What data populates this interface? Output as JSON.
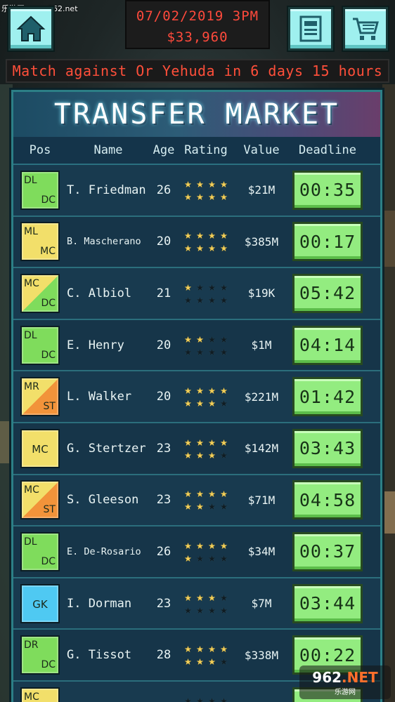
{
  "watermark_top": "乐游网 www.962.net",
  "header": {
    "date": "07/02/2019 3PM",
    "money": "$33,960",
    "home_icon": "home-icon",
    "news_icon": "newspaper-icon",
    "cart_icon": "cart-icon"
  },
  "ticker": "Match against Or Yehuda in 6 days 15 hours",
  "market": {
    "title": "TRANSFER MARKET",
    "columns": [
      "Pos",
      "Name",
      "Age",
      "Rating",
      "Value",
      "Deadline"
    ],
    "players": [
      {
        "pos1": "DL",
        "pos2": "DC",
        "name": "T. Friedman",
        "age": "26",
        "stars": 8,
        "value": "$21M",
        "deadline": "00:35",
        "colors": [
          "#7fdc5c",
          "#7fdc5c"
        ]
      },
      {
        "pos1": "ML",
        "pos2": "MC",
        "name": "B. Mascherano",
        "age": "20",
        "stars": 8,
        "value": "$385M",
        "deadline": "00:17",
        "colors": [
          "#f2df6a",
          "#f2df6a"
        ]
      },
      {
        "pos1": "MC",
        "pos2": "DC",
        "name": "C. Albiol",
        "age": "21",
        "stars": 1,
        "value": "$19K",
        "deadline": "05:42",
        "colors": [
          "#f2df6a",
          "#7fdc5c"
        ]
      },
      {
        "pos1": "DL",
        "pos2": "DC",
        "name": "E. Henry",
        "age": "20",
        "stars": 2,
        "value": "$1M",
        "deadline": "04:14",
        "colors": [
          "#7fdc5c",
          "#7fdc5c"
        ]
      },
      {
        "pos1": "MR",
        "pos2": "ST",
        "name": "L. Walker",
        "age": "20",
        "stars": 7,
        "value": "$221M",
        "deadline": "01:42",
        "colors": [
          "#f2df6a",
          "#f2933a"
        ]
      },
      {
        "pos1": "",
        "pos2": "",
        "posc": "MC",
        "name": "G. Stertzer",
        "age": "23",
        "stars": 7,
        "value": "$142M",
        "deadline": "03:43",
        "colors": [
          "#f2df6a",
          "#f2df6a"
        ]
      },
      {
        "pos1": "MC",
        "pos2": "ST",
        "name": "S. Gleeson",
        "age": "23",
        "stars": 6,
        "value": "$71M",
        "deadline": "04:58",
        "colors": [
          "#f2df6a",
          "#f2933a"
        ]
      },
      {
        "pos1": "DL",
        "pos2": "DC",
        "name": "E. De-Rosario",
        "age": "26",
        "stars": 5,
        "value": "$34M",
        "deadline": "00:37",
        "colors": [
          "#7fdc5c",
          "#7fdc5c"
        ]
      },
      {
        "pos1": "",
        "pos2": "",
        "posc": "GK",
        "name": "I. Dorman",
        "age": "23",
        "stars": 3,
        "value": "$7M",
        "deadline": "03:44",
        "colors": [
          "#4fc9f2",
          "#4fc9f2"
        ]
      },
      {
        "pos1": "DR",
        "pos2": "DC",
        "name": "G. Tissot",
        "age": "28",
        "stars": 7,
        "value": "$338M",
        "deadline": "00:22",
        "colors": [
          "#7fdc5c",
          "#7fdc5c"
        ]
      },
      {
        "pos1": "MC",
        "pos2": "",
        "name": "",
        "age": "",
        "stars": 0,
        "value": "",
        "deadline": "",
        "colors": [
          "#f2df6a",
          "#f2df6a"
        ]
      }
    ]
  },
  "watermark_br": {
    "big_a": "962",
    "big_b": ".NET",
    "small": "乐游网"
  }
}
